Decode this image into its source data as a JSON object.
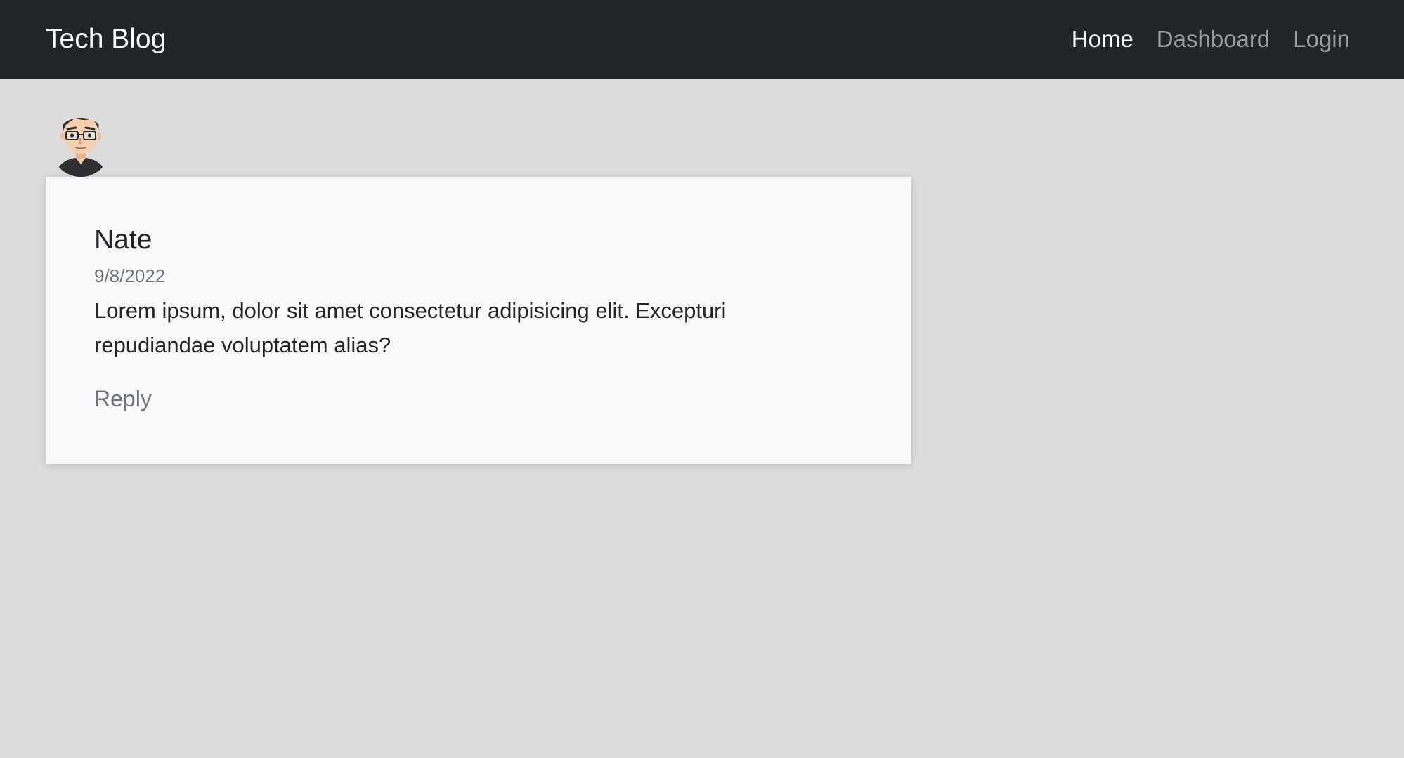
{
  "navbar": {
    "brand": "Tech Blog",
    "links": [
      {
        "label": "Home",
        "active": true
      },
      {
        "label": "Dashboard",
        "active": false
      },
      {
        "label": "Login",
        "active": false
      }
    ]
  },
  "comment": {
    "avatar": "avatar-icon",
    "author": "Nate",
    "date": "9/8/2022",
    "text": "Lorem ipsum, dolor sit amet consectetur adipisicing elit. Excepturi repudiandae voluptatem alias?",
    "reply_label": "Reply"
  },
  "colors": {
    "navbar_bg": "#212529",
    "page_bg": "#dcdcdc",
    "card_bg": "#f9f9f9",
    "muted_text": "#6c757d"
  }
}
